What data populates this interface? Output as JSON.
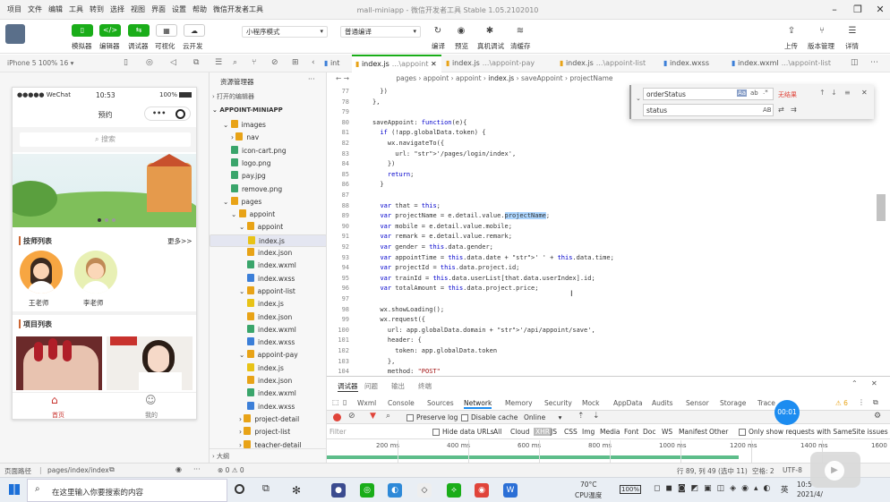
{
  "menu": [
    "项目",
    "文件",
    "编辑",
    "工具",
    "转到",
    "选择",
    "视图",
    "界面",
    "设置",
    "帮助",
    "微信开发者工具"
  ],
  "window_title": "mall-miniapp - 微信开发者工具 Stable 1.05.2102010",
  "toolbar": {
    "buttons": [
      "模拟器",
      "编辑器",
      "调试器",
      "可视化",
      "云开发"
    ],
    "mode_select": "小程序模式",
    "compile_select": "普通编译",
    "actions": [
      "编译",
      "预览",
      "真机调试",
      "清缓存"
    ],
    "right": [
      "上传",
      "版本管理",
      "详情"
    ]
  },
  "device": "iPhone 5 100% 16 ▾",
  "editor_tabs": [
    {
      "label": "int",
      "active": false
    },
    {
      "label": "index.js",
      "path": "...\\appoint",
      "active": true
    },
    {
      "label": "index.js",
      "path": "...\\appoint-pay",
      "active": false
    },
    {
      "label": "index.js",
      "path": "...\\appoint-list",
      "active": false
    },
    {
      "label": "index.wxss",
      "path": "",
      "active": false
    },
    {
      "label": "index.wxml",
      "path": "...\\appoint-list",
      "active": false
    }
  ],
  "phone": {
    "carrier": "●●●●● WeChat",
    "wifi": "WiFi",
    "time": "10:53",
    "battery": "100%",
    "title": "预约",
    "search_placeholder": "搜索",
    "section_tech": "技师列表",
    "more": "更多>>",
    "techs": [
      "王老师",
      "李老师"
    ],
    "section_projects": "项目列表",
    "tab_home": "首页",
    "tab_mine": "我的"
  },
  "explorer": {
    "title": "资源管理器",
    "open_editors": "打开的编辑器",
    "project": "APPOINT-MINIAPP",
    "outline": "大纲",
    "items": [
      {
        "label": "images",
        "depth": 1,
        "type": "folder"
      },
      {
        "label": "nav",
        "depth": 2,
        "type": "folder"
      },
      {
        "label": "icon-cart.png",
        "depth": 2,
        "type": "img"
      },
      {
        "label": "logo.png",
        "depth": 2,
        "type": "img"
      },
      {
        "label": "pay.jpg",
        "depth": 2,
        "type": "img"
      },
      {
        "label": "remove.png",
        "depth": 2,
        "type": "img"
      },
      {
        "label": "pages",
        "depth": 1,
        "type": "folder"
      },
      {
        "label": "appoint",
        "depth": 2,
        "type": "folder"
      },
      {
        "label": "appoint",
        "depth": 3,
        "type": "folder"
      },
      {
        "label": "index.js",
        "depth": 4,
        "type": "js",
        "selected": true
      },
      {
        "label": "index.json",
        "depth": 4,
        "type": "json"
      },
      {
        "label": "index.wxml",
        "depth": 4,
        "type": "wxml"
      },
      {
        "label": "index.wxss",
        "depth": 4,
        "type": "wxss"
      },
      {
        "label": "appoint-list",
        "depth": 3,
        "type": "folder"
      },
      {
        "label": "index.js",
        "depth": 4,
        "type": "js"
      },
      {
        "label": "index.json",
        "depth": 4,
        "type": "json"
      },
      {
        "label": "index.wxml",
        "depth": 4,
        "type": "wxml"
      },
      {
        "label": "index.wxss",
        "depth": 4,
        "type": "wxss"
      },
      {
        "label": "appoint-pay",
        "depth": 3,
        "type": "folder"
      },
      {
        "label": "index.js",
        "depth": 4,
        "type": "js"
      },
      {
        "label": "index.json",
        "depth": 4,
        "type": "json"
      },
      {
        "label": "index.wxml",
        "depth": 4,
        "type": "wxml"
      },
      {
        "label": "index.wxss",
        "depth": 4,
        "type": "wxss"
      },
      {
        "label": "project-detail",
        "depth": 3,
        "type": "folder"
      },
      {
        "label": "project-list",
        "depth": 3,
        "type": "folder"
      },
      {
        "label": "teacher-detail",
        "depth": 3,
        "type": "folder"
      }
    ]
  },
  "breadcrumb": [
    "pages",
    "appoint",
    "appoint",
    "index.js",
    "saveAppoint",
    "projectName"
  ],
  "code": [
    {
      "n": "77",
      "t": "  })"
    },
    {
      "n": "78",
      "t": "},"
    },
    {
      "n": "79",
      "t": ""
    },
    {
      "n": "80",
      "t": "saveAppoint: function(e){"
    },
    {
      "n": "81",
      "t": "  if (!app.globalData.token) {"
    },
    {
      "n": "82",
      "t": "    wx.navigateTo({"
    },
    {
      "n": "83",
      "t": "      url: '/pages/login/index',"
    },
    {
      "n": "84",
      "t": "    })"
    },
    {
      "n": "85",
      "t": "    return;"
    },
    {
      "n": "86",
      "t": "  }"
    },
    {
      "n": "87",
      "t": ""
    },
    {
      "n": "88",
      "t": "  var that = this;"
    },
    {
      "n": "89",
      "t": "  var projectName = e.detail.value.projectName;"
    },
    {
      "n": "90",
      "t": "  var mobile = e.detail.value.mobile;"
    },
    {
      "n": "91",
      "t": "  var remark = e.detail.value.remark;"
    },
    {
      "n": "92",
      "t": "  var gender = this.data.gender;"
    },
    {
      "n": "93",
      "t": "  var appointTime = this.data.date + ' ' + this.data.time;"
    },
    {
      "n": "94",
      "t": "  var projectId = this.data.project.id;"
    },
    {
      "n": "95",
      "t": "  var trainId = this.data.userList[that.data.userIndex].id;"
    },
    {
      "n": "96",
      "t": "  var totalAmount = this.data.project.price;"
    },
    {
      "n": "97",
      "t": ""
    },
    {
      "n": "98",
      "t": "  wx.showLoading();"
    },
    {
      "n": "99",
      "t": "  wx.request({"
    },
    {
      "n": "100",
      "t": "    url: app.globalData.domain + '/api/appoint/save',"
    },
    {
      "n": "101",
      "t": "    header: {"
    },
    {
      "n": "102",
      "t": "      token: app.globalData.token"
    },
    {
      "n": "103",
      "t": "    },"
    },
    {
      "n": "104",
      "t": "    method: \"POST\""
    }
  ],
  "find": {
    "search": "orderStatus",
    "replace": "status",
    "result": "无结果",
    "opt_case": "Aa",
    "opt_word": "ab",
    "opt_regex": ".*",
    "opt_preserve": "AB"
  },
  "devtools": {
    "top_tabs": [
      "调试器",
      "问题",
      "输出",
      "终端"
    ],
    "tabs": [
      "Wxml",
      "Console",
      "Sources",
      "Network",
      "Memory",
      "Security",
      "Mock",
      "AppData",
      "Audits",
      "Sensor",
      "Storage",
      "Trace"
    ],
    "active_tab": "Network",
    "warn_count": "6",
    "preserve_log": "Preserve log",
    "disable_cache": "Disable cache",
    "online": "Online",
    "filter_placeholder": "Filter",
    "hide_data_urls": "Hide data URLs",
    "types": [
      "All",
      "Cloud",
      "XHR",
      "JS",
      "CSS",
      "Img",
      "Media",
      "Font",
      "Doc",
      "WS",
      "Manifest",
      "Other"
    ],
    "same_site": "Only show requests with SameSite issues",
    "timeline": [
      "200 ms",
      "400 ms",
      "600 ms",
      "800 ms",
      "1000 ms",
      "1200 ms",
      "1400 ms",
      "1600"
    ],
    "timer": "00:01"
  },
  "status": {
    "path_label": "页面路径",
    "path": "pages/index/index",
    "errors": "⊗ 0 ⚠ 0",
    "position": "行 89, 列 49 (选中 11)",
    "spaces": "空格: 2",
    "encoding": "UTF-8"
  },
  "taskbar": {
    "search": "在这里输入你要搜索的内容",
    "temp": "70°C",
    "cpu": "CPU温度",
    "battery": "100%",
    "lang": "英",
    "time": "10:5",
    "date": "2021/4/"
  }
}
